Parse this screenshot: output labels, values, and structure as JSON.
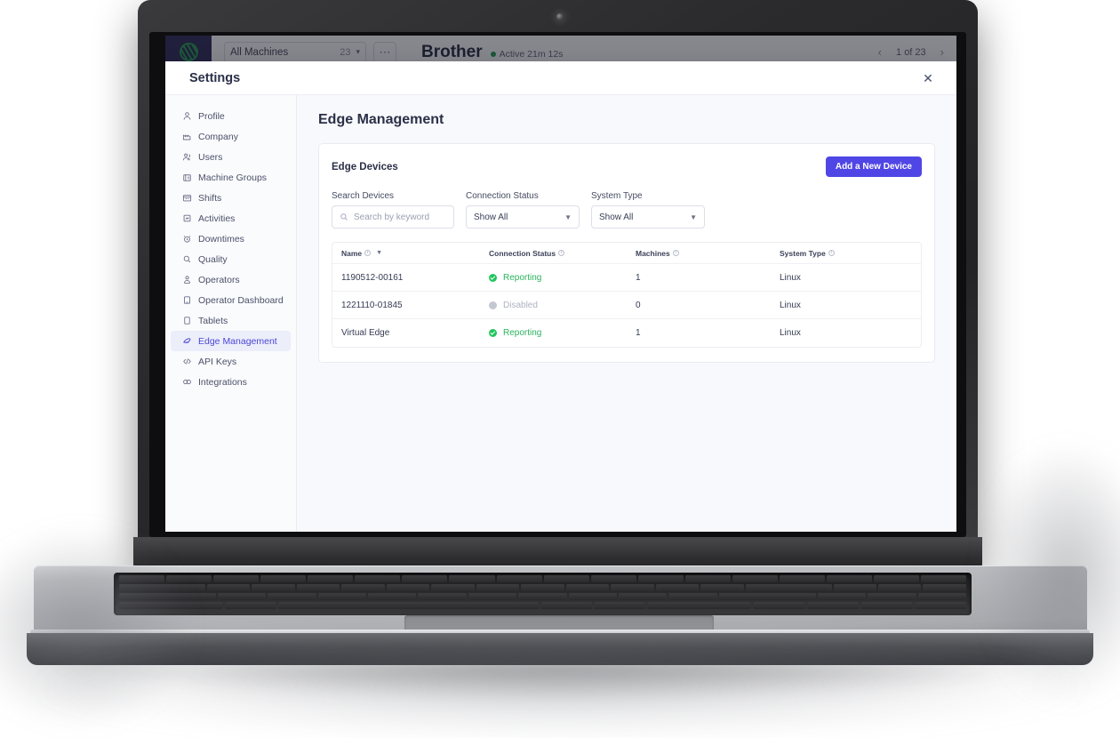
{
  "background_app": {
    "logo_icon": "striped-circle-logo",
    "machine_selector": {
      "label": "All Machines",
      "count": "23",
      "chevron_icon": "chevron-down-icon"
    },
    "kebab_icon": "ellipsis-horizontal-icon",
    "title": "Brother",
    "status": "Active 21m 12s",
    "pager": {
      "prev_icon": "chevron-left-icon",
      "label": "1 of 23",
      "next_icon": "chevron-right-icon"
    }
  },
  "modal": {
    "title": "Settings",
    "close_icon": "close-icon"
  },
  "sidebar": {
    "items": [
      {
        "label": "Profile",
        "icon": "user-icon",
        "active": false
      },
      {
        "label": "Company",
        "icon": "factory-icon",
        "active": false
      },
      {
        "label": "Users",
        "icon": "users-icon",
        "active": false
      },
      {
        "label": "Machine Groups",
        "icon": "machine-icon",
        "active": false
      },
      {
        "label": "Shifts",
        "icon": "calendar-icon",
        "active": false
      },
      {
        "label": "Activities",
        "icon": "activity-icon",
        "active": false
      },
      {
        "label": "Downtimes",
        "icon": "alarm-clock-icon",
        "active": false
      },
      {
        "label": "Quality",
        "icon": "magnifier-icon",
        "active": false
      },
      {
        "label": "Operators",
        "icon": "operator-icon",
        "active": false
      },
      {
        "label": "Operator Dashboard",
        "icon": "tablet-icon",
        "active": false
      },
      {
        "label": "Tablets",
        "icon": "tablet-outline-icon",
        "active": false
      },
      {
        "label": "Edge Management",
        "icon": "edge-device-icon",
        "active": true
      },
      {
        "label": "API Keys",
        "icon": "code-brackets-icon",
        "active": false
      },
      {
        "label": "Integrations",
        "icon": "integrations-icon",
        "active": false
      }
    ]
  },
  "main": {
    "page_title": "Edge Management",
    "card": {
      "title": "Edge Devices",
      "add_button": "Add a New Device",
      "filters": [
        {
          "label": "Search Devices",
          "type": "search",
          "value": "",
          "placeholder": "Search by keyword",
          "icon": "search-icon"
        },
        {
          "label": "Connection Status",
          "type": "select",
          "value": "Show All",
          "icon": "chevron-down-icon"
        },
        {
          "label": "System Type",
          "type": "select",
          "value": "Show All",
          "icon": "chevron-down-icon"
        }
      ],
      "table": {
        "columns": [
          {
            "label": "Name",
            "info": true,
            "sortable": true
          },
          {
            "label": "Connection Status",
            "info": true,
            "sortable": false
          },
          {
            "label": "Machines",
            "info": true,
            "sortable": false
          },
          {
            "label": "System Type",
            "info": true,
            "sortable": false
          }
        ],
        "rows": [
          {
            "name": "1190512-00161",
            "connection": "Reporting",
            "state": "ok",
            "machines": "1",
            "system_type": "Linux"
          },
          {
            "name": "1221110-01845",
            "connection": "Disabled",
            "state": "off",
            "machines": "0",
            "system_type": "Linux"
          },
          {
            "name": "Virtual Edge",
            "connection": "Reporting",
            "state": "ok",
            "machines": "1",
            "system_type": "Linux"
          }
        ]
      }
    }
  },
  "colors": {
    "accent": "#4f46e5",
    "status_ok": "#22c55e",
    "status_off": "#c3c7d2",
    "content_bg": "#f8f9fc",
    "sidebar_bg": "#fafbfd",
    "logo_navy": "#262353",
    "logo_green": "#1f9a4a"
  }
}
